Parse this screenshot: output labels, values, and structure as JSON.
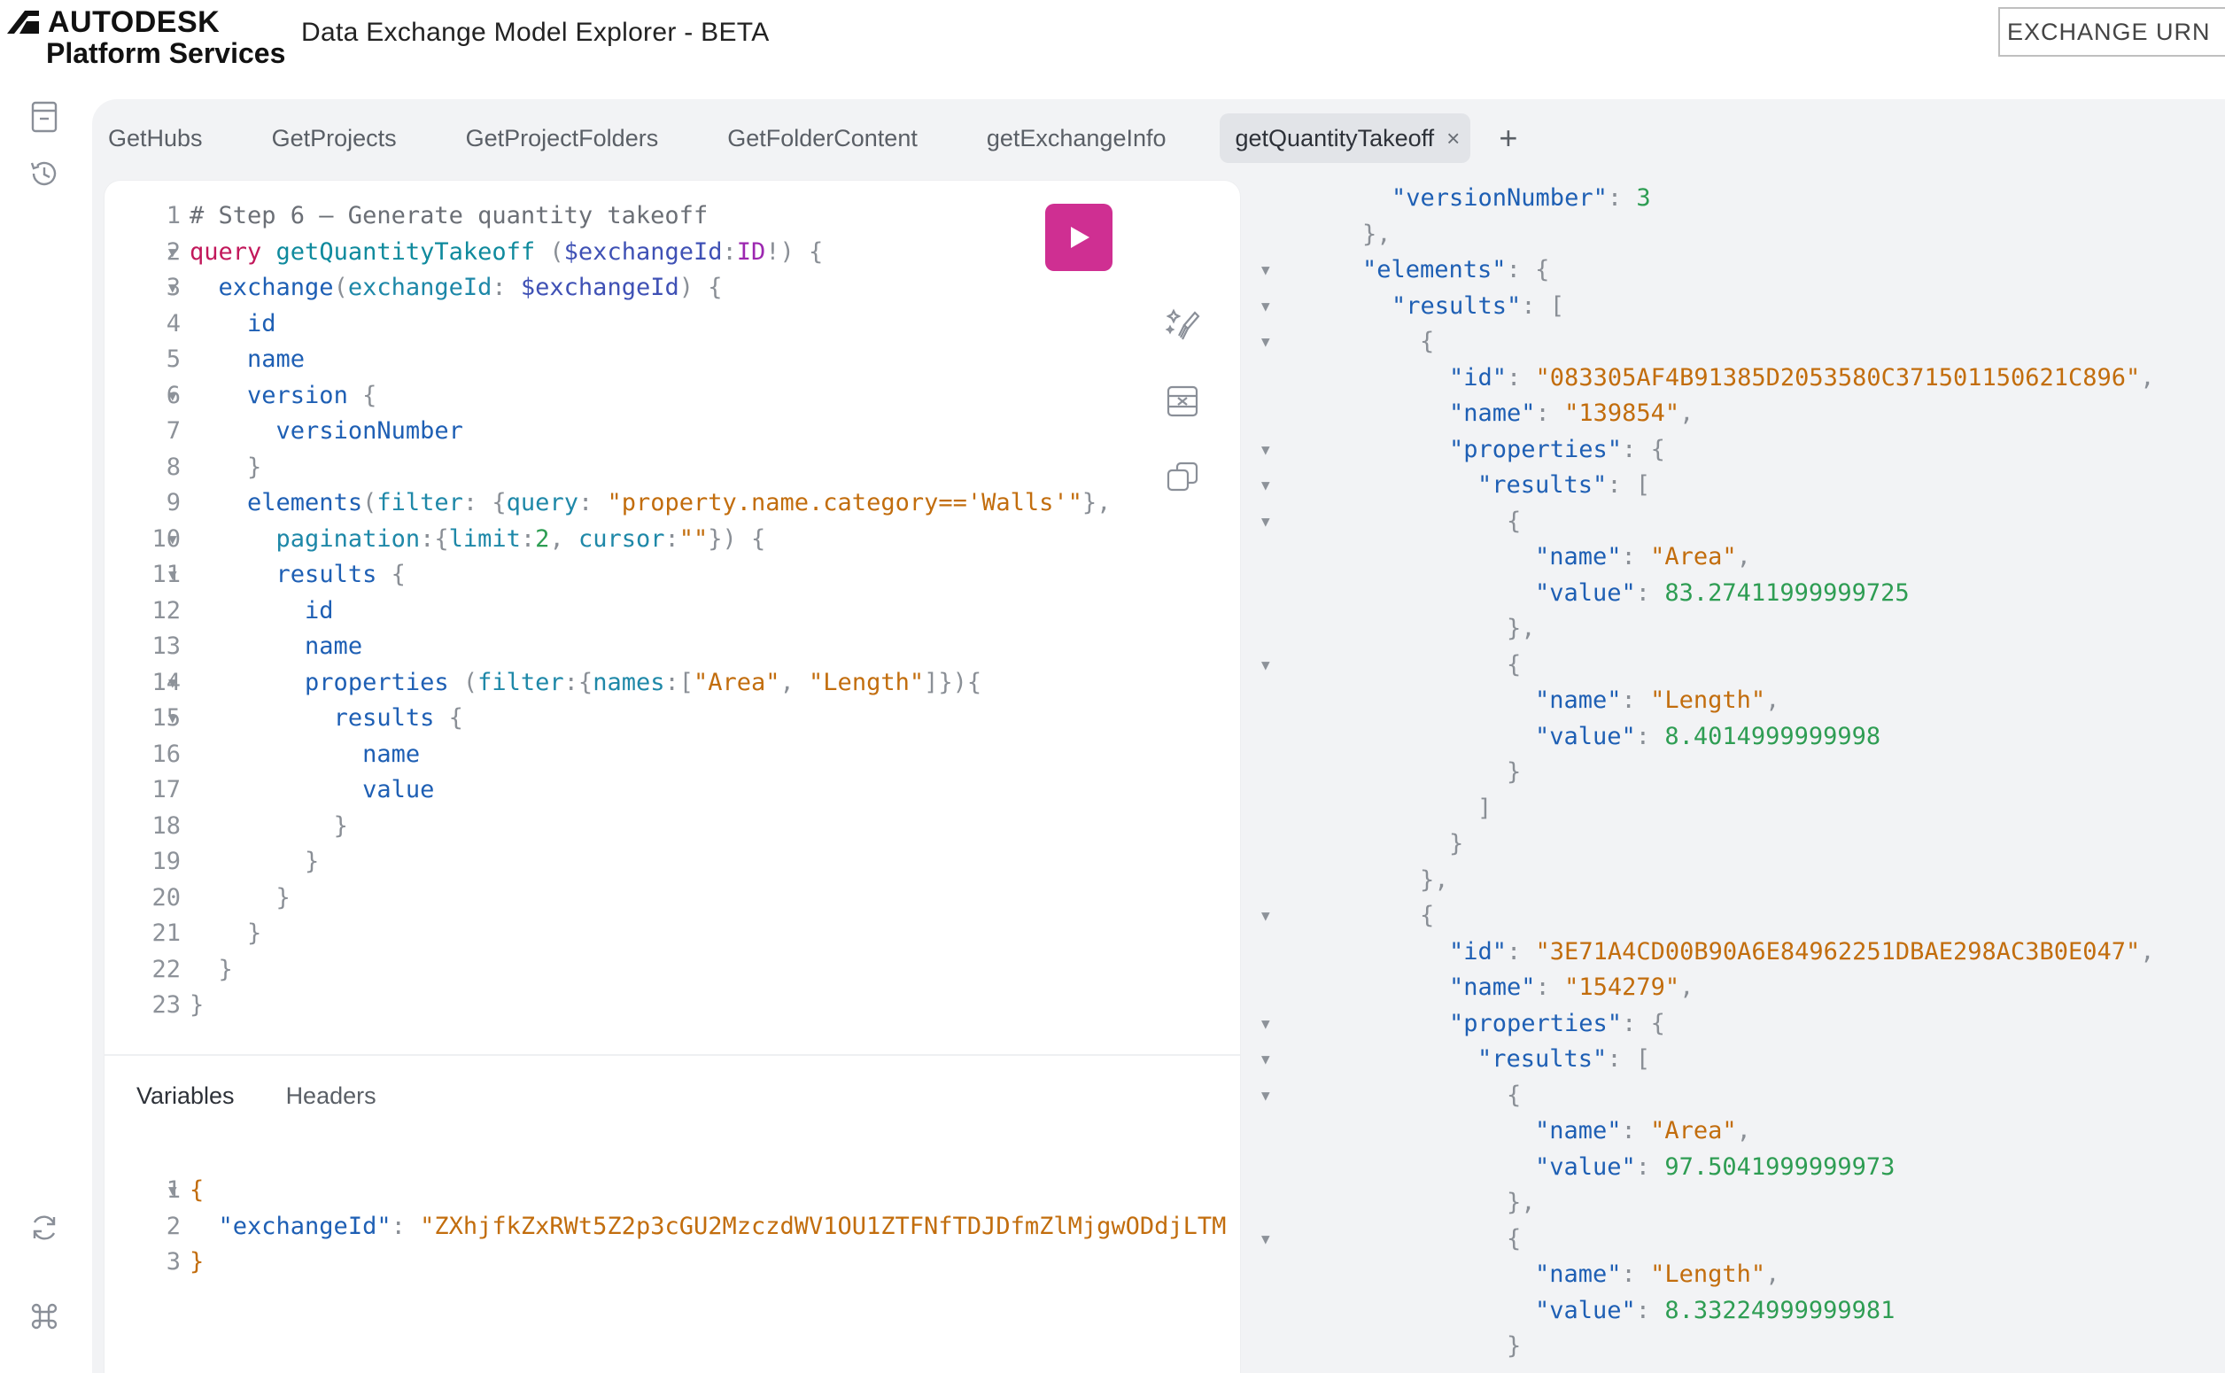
{
  "header": {
    "brand_top": "AUTODESK",
    "brand_bottom": "Platform Services",
    "app_title": "Data Exchange Model Explorer - BETA",
    "urn_input_value": "EXCHANGE URN H"
  },
  "rail": {
    "icons": [
      "docs-icon",
      "history-icon",
      "refresh-icon",
      "shortcut-key-icon"
    ]
  },
  "tabs": {
    "items": [
      {
        "label": "GetHubs"
      },
      {
        "label": "GetProjects"
      },
      {
        "label": "GetProjectFolders"
      },
      {
        "label": "GetFolderContent"
      },
      {
        "label": "getExchangeInfo"
      },
      {
        "label": "getQuantityTakeoff"
      }
    ],
    "active_index": 5,
    "close_glyph": "×",
    "add_glyph": "+"
  },
  "editor": {
    "lines": [
      {
        "n": "1",
        "fold": false,
        "tokens": [
          [
            "c-comment",
            "# Step 6 – Generate quantity takeoff"
          ]
        ]
      },
      {
        "n": "2",
        "fold": true,
        "tokens": [
          [
            "c-kw",
            "query"
          ],
          [
            "",
            " "
          ],
          [
            "c-def",
            "getQuantityTakeoff"
          ],
          [
            "c-punc",
            " ("
          ],
          [
            "c-var",
            "$exchangeId"
          ],
          [
            "c-punc",
            ":"
          ],
          [
            "c-type",
            "ID"
          ],
          [
            "c-punc",
            "!) {"
          ]
        ]
      },
      {
        "n": "3",
        "fold": true,
        "tokens": [
          [
            "",
            "  "
          ],
          [
            "c-field",
            "exchange"
          ],
          [
            "c-punc",
            "("
          ],
          [
            "c-arg",
            "exchangeId"
          ],
          [
            "c-punc",
            ": "
          ],
          [
            "c-var",
            "$exchangeId"
          ],
          [
            "c-punc",
            ") {"
          ]
        ]
      },
      {
        "n": "4",
        "fold": false,
        "tokens": [
          [
            "",
            "    "
          ],
          [
            "c-field",
            "id"
          ]
        ]
      },
      {
        "n": "5",
        "fold": false,
        "tokens": [
          [
            "",
            "    "
          ],
          [
            "c-field",
            "name"
          ]
        ]
      },
      {
        "n": "6",
        "fold": true,
        "tokens": [
          [
            "",
            "    "
          ],
          [
            "c-field",
            "version"
          ],
          [
            "c-punc",
            " {"
          ]
        ]
      },
      {
        "n": "7",
        "fold": false,
        "tokens": [
          [
            "",
            "      "
          ],
          [
            "c-field",
            "versionNumber"
          ]
        ]
      },
      {
        "n": "8",
        "fold": false,
        "tokens": [
          [
            "",
            "    "
          ],
          [
            "c-punc",
            "}"
          ]
        ]
      },
      {
        "n": "9",
        "fold": false,
        "tokens": [
          [
            "",
            "    "
          ],
          [
            "c-field",
            "elements"
          ],
          [
            "c-punc",
            "("
          ],
          [
            "c-arg",
            "filter"
          ],
          [
            "c-punc",
            ": {"
          ],
          [
            "c-arg",
            "query"
          ],
          [
            "c-punc",
            ": "
          ],
          [
            "c-str",
            "\"property.name.category=='Walls'\""
          ],
          [
            "c-punc",
            "},"
          ]
        ]
      },
      {
        "n": "10",
        "fold": true,
        "tokens": [
          [
            "",
            "      "
          ],
          [
            "c-arg",
            "pagination"
          ],
          [
            "c-punc",
            ":{"
          ],
          [
            "c-arg",
            "limit"
          ],
          [
            "c-punc",
            ":"
          ],
          [
            "c-num",
            "2"
          ],
          [
            "c-punc",
            ", "
          ],
          [
            "c-arg",
            "cursor"
          ],
          [
            "c-punc",
            ":"
          ],
          [
            "c-str",
            "\"\""
          ],
          [
            "c-punc",
            "}) {"
          ]
        ]
      },
      {
        "n": "11",
        "fold": true,
        "tokens": [
          [
            "",
            "      "
          ],
          [
            "c-field",
            "results"
          ],
          [
            "c-punc",
            " {"
          ]
        ]
      },
      {
        "n": "12",
        "fold": false,
        "tokens": [
          [
            "",
            "        "
          ],
          [
            "c-field",
            "id"
          ]
        ]
      },
      {
        "n": "13",
        "fold": false,
        "tokens": [
          [
            "",
            "        "
          ],
          [
            "c-field",
            "name"
          ]
        ]
      },
      {
        "n": "14",
        "fold": true,
        "tokens": [
          [
            "",
            "        "
          ],
          [
            "c-field",
            "properties"
          ],
          [
            "c-punc",
            " ("
          ],
          [
            "c-arg",
            "filter"
          ],
          [
            "c-punc",
            ":{"
          ],
          [
            "c-arg",
            "names"
          ],
          [
            "c-punc",
            ":["
          ],
          [
            "c-str",
            "\"Area\""
          ],
          [
            "c-punc",
            ", "
          ],
          [
            "c-str",
            "\"Length\""
          ],
          [
            "c-punc",
            "]}){"
          ]
        ]
      },
      {
        "n": "15",
        "fold": true,
        "tokens": [
          [
            "",
            "          "
          ],
          [
            "c-field",
            "results"
          ],
          [
            "c-punc",
            " {"
          ]
        ]
      },
      {
        "n": "16",
        "fold": false,
        "tokens": [
          [
            "",
            "            "
          ],
          [
            "c-field",
            "name"
          ]
        ]
      },
      {
        "n": "17",
        "fold": false,
        "tokens": [
          [
            "",
            "            "
          ],
          [
            "c-field",
            "value"
          ]
        ]
      },
      {
        "n": "18",
        "fold": false,
        "tokens": [
          [
            "",
            "          "
          ],
          [
            "c-punc",
            "}"
          ]
        ]
      },
      {
        "n": "19",
        "fold": false,
        "tokens": [
          [
            "",
            "        "
          ],
          [
            "c-punc",
            "}"
          ]
        ]
      },
      {
        "n": "20",
        "fold": false,
        "tokens": [
          [
            "",
            "      "
          ],
          [
            "c-punc",
            "}"
          ]
        ]
      },
      {
        "n": "21",
        "fold": false,
        "tokens": [
          [
            "",
            "    "
          ],
          [
            "c-punc",
            "}"
          ]
        ]
      },
      {
        "n": "22",
        "fold": false,
        "tokens": [
          [
            "",
            "  "
          ],
          [
            "c-punc",
            "}"
          ]
        ]
      },
      {
        "n": "23",
        "fold": false,
        "tokens": [
          [
            "c-punc",
            "}"
          ]
        ]
      }
    ],
    "tools": [
      "play-icon",
      "prettify-icon",
      "merge-icon",
      "copy-icon"
    ]
  },
  "variables_panel": {
    "tabs": [
      {
        "label": "Variables"
      },
      {
        "label": "Headers"
      }
    ],
    "lines": [
      {
        "n": "1",
        "fold": true,
        "tokens": [
          [
            "c-str",
            "{"
          ]
        ]
      },
      {
        "n": "2",
        "fold": false,
        "tokens": [
          [
            "",
            "  "
          ],
          [
            "c-field",
            "\"exchangeId\""
          ],
          [
            "c-punc",
            ": "
          ],
          [
            "c-str",
            "\"ZXhjfkZxRWt5Z2p3cGU2MzczdWV1OU1ZTFNfTDJDfmZlMjgwODdjLTM"
          ]
        ]
      },
      {
        "n": "3",
        "fold": false,
        "tokens": [
          [
            "c-str",
            "}"
          ]
        ]
      }
    ]
  },
  "result": {
    "lines": [
      {
        "fold": false,
        "indent": 5,
        "tokens": [
          [
            "r-key",
            "\"versionNumber\""
          ],
          [
            "r-punc",
            ": "
          ],
          [
            "r-num",
            "3"
          ]
        ]
      },
      {
        "fold": false,
        "indent": 4,
        "tokens": [
          [
            "r-punc",
            "},"
          ]
        ]
      },
      {
        "fold": true,
        "indent": 4,
        "tokens": [
          [
            "r-key",
            "\"elements\""
          ],
          [
            "r-punc",
            ": {"
          ]
        ]
      },
      {
        "fold": true,
        "indent": 5,
        "tokens": [
          [
            "r-key",
            "\"results\""
          ],
          [
            "r-punc",
            ": ["
          ]
        ]
      },
      {
        "fold": true,
        "indent": 6,
        "tokens": [
          [
            "r-punc",
            "{"
          ]
        ]
      },
      {
        "fold": false,
        "indent": 7,
        "tokens": [
          [
            "r-key",
            "\"id\""
          ],
          [
            "r-punc",
            ": "
          ],
          [
            "r-str",
            "\"083305AF4B91385D2053580C371501150621C896\""
          ],
          [
            "r-punc",
            ","
          ]
        ]
      },
      {
        "fold": false,
        "indent": 7,
        "tokens": [
          [
            "r-key",
            "\"name\""
          ],
          [
            "r-punc",
            ": "
          ],
          [
            "r-str",
            "\"139854\""
          ],
          [
            "r-punc",
            ","
          ]
        ]
      },
      {
        "fold": true,
        "indent": 7,
        "tokens": [
          [
            "r-key",
            "\"properties\""
          ],
          [
            "r-punc",
            ": {"
          ]
        ]
      },
      {
        "fold": true,
        "indent": 8,
        "tokens": [
          [
            "r-key",
            "\"results\""
          ],
          [
            "r-punc",
            ": ["
          ]
        ]
      },
      {
        "fold": true,
        "indent": 9,
        "tokens": [
          [
            "r-punc",
            "{"
          ]
        ]
      },
      {
        "fold": false,
        "indent": 10,
        "tokens": [
          [
            "r-key",
            "\"name\""
          ],
          [
            "r-punc",
            ": "
          ],
          [
            "r-str",
            "\"Area\""
          ],
          [
            "r-punc",
            ","
          ]
        ]
      },
      {
        "fold": false,
        "indent": 10,
        "tokens": [
          [
            "r-key",
            "\"value\""
          ],
          [
            "r-punc",
            ": "
          ],
          [
            "r-num",
            "83.27411999999725"
          ]
        ]
      },
      {
        "fold": false,
        "indent": 9,
        "tokens": [
          [
            "r-punc",
            "},"
          ]
        ]
      },
      {
        "fold": true,
        "indent": 9,
        "tokens": [
          [
            "r-punc",
            "{"
          ]
        ]
      },
      {
        "fold": false,
        "indent": 10,
        "tokens": [
          [
            "r-key",
            "\"name\""
          ],
          [
            "r-punc",
            ": "
          ],
          [
            "r-str",
            "\"Length\""
          ],
          [
            "r-punc",
            ","
          ]
        ]
      },
      {
        "fold": false,
        "indent": 10,
        "tokens": [
          [
            "r-key",
            "\"value\""
          ],
          [
            "r-punc",
            ": "
          ],
          [
            "r-num",
            "8.4014999999998"
          ]
        ]
      },
      {
        "fold": false,
        "indent": 9,
        "tokens": [
          [
            "r-punc",
            "}"
          ]
        ]
      },
      {
        "fold": false,
        "indent": 8,
        "tokens": [
          [
            "r-punc",
            "]"
          ]
        ]
      },
      {
        "fold": false,
        "indent": 7,
        "tokens": [
          [
            "r-punc",
            "}"
          ]
        ]
      },
      {
        "fold": false,
        "indent": 6,
        "tokens": [
          [
            "r-punc",
            "},"
          ]
        ]
      },
      {
        "fold": true,
        "indent": 6,
        "tokens": [
          [
            "r-punc",
            "{"
          ]
        ]
      },
      {
        "fold": false,
        "indent": 7,
        "tokens": [
          [
            "r-key",
            "\"id\""
          ],
          [
            "r-punc",
            ": "
          ],
          [
            "r-str",
            "\"3E71A4CD00B90A6E84962251DBAE298AC3B0E047\""
          ],
          [
            "r-punc",
            ","
          ]
        ]
      },
      {
        "fold": false,
        "indent": 7,
        "tokens": [
          [
            "r-key",
            "\"name\""
          ],
          [
            "r-punc",
            ": "
          ],
          [
            "r-str",
            "\"154279\""
          ],
          [
            "r-punc",
            ","
          ]
        ]
      },
      {
        "fold": true,
        "indent": 7,
        "tokens": [
          [
            "r-key",
            "\"properties\""
          ],
          [
            "r-punc",
            ": {"
          ]
        ]
      },
      {
        "fold": true,
        "indent": 8,
        "tokens": [
          [
            "r-key",
            "\"results\""
          ],
          [
            "r-punc",
            ": ["
          ]
        ]
      },
      {
        "fold": true,
        "indent": 9,
        "tokens": [
          [
            "r-punc",
            "{"
          ]
        ]
      },
      {
        "fold": false,
        "indent": 10,
        "tokens": [
          [
            "r-key",
            "\"name\""
          ],
          [
            "r-punc",
            ": "
          ],
          [
            "r-str",
            "\"Area\""
          ],
          [
            "r-punc",
            ","
          ]
        ]
      },
      {
        "fold": false,
        "indent": 10,
        "tokens": [
          [
            "r-key",
            "\"value\""
          ],
          [
            "r-punc",
            ": "
          ],
          [
            "r-num",
            "97.5041999999973"
          ]
        ]
      },
      {
        "fold": false,
        "indent": 9,
        "tokens": [
          [
            "r-punc",
            "},"
          ]
        ]
      },
      {
        "fold": true,
        "indent": 9,
        "tokens": [
          [
            "r-punc",
            "{"
          ]
        ]
      },
      {
        "fold": false,
        "indent": 10,
        "tokens": [
          [
            "r-key",
            "\"name\""
          ],
          [
            "r-punc",
            ": "
          ],
          [
            "r-str",
            "\"Length\""
          ],
          [
            "r-punc",
            ","
          ]
        ]
      },
      {
        "fold": false,
        "indent": 10,
        "tokens": [
          [
            "r-key",
            "\"value\""
          ],
          [
            "r-punc",
            ": "
          ],
          [
            "r-num",
            "8.33224999999981"
          ]
        ]
      },
      {
        "fold": false,
        "indent": 9,
        "tokens": [
          [
            "r-punc",
            "}"
          ]
        ]
      }
    ]
  }
}
